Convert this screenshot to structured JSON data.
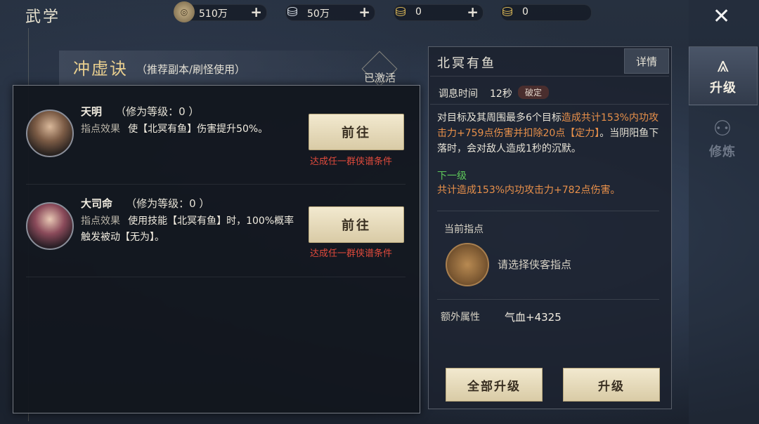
{
  "header": {
    "title": "武学"
  },
  "resources": [
    {
      "name": "copper-coin",
      "value": "510万"
    },
    {
      "name": "silver-ingot",
      "value": "50万"
    },
    {
      "name": "gold-ingot",
      "value": "0"
    },
    {
      "name": "bound-gold-ingot",
      "value": "0"
    }
  ],
  "side_tabs": {
    "upgrade": "升级",
    "cultivate": "修炼"
  },
  "skill": {
    "name": "冲虚诀",
    "subtitle": "（推荐副本/刷怪使用）",
    "activated": "已激活"
  },
  "popup": {
    "npcs": [
      {
        "name": "天明",
        "level": "（修为等级：0 ）",
        "effect_label": "指点效果",
        "effect_text": "使【北冥有鱼】伤害提升50%。",
        "button": "前往",
        "condition": "达成任一群侠谱条件"
      },
      {
        "name": "大司命",
        "level": "（修为等级：0 ）",
        "effect_label": "指点效果",
        "effect_text": "使用技能【北冥有鱼】时，100%概率触发被动【无为】。",
        "button": "前往",
        "condition": "达成任一群侠谱条件"
      }
    ]
  },
  "detail": {
    "title": "北冥有鱼",
    "detail_button": "详情",
    "cooldown_label": "调息时间",
    "cooldown_value": "12秒",
    "badge": "破定",
    "desc_a": "对目标及其周围最多6个目标",
    "desc_b": "造成共计153%内功攻击力+759点伤害并扣除20点【定力】",
    "desc_c": "。当阴阳鱼下落时，会对敌人造成1秒的沉默。",
    "next_label": "下一级",
    "next_text": "共计造成153%内功攻击力+782点伤害。",
    "current_label": "当前指点",
    "slot_hint": "请选择侠客指点",
    "extra_label": "额外属性",
    "extra_value": "气血+4325",
    "btn_all": "全部升级",
    "btn_upgrade": "升级"
  }
}
